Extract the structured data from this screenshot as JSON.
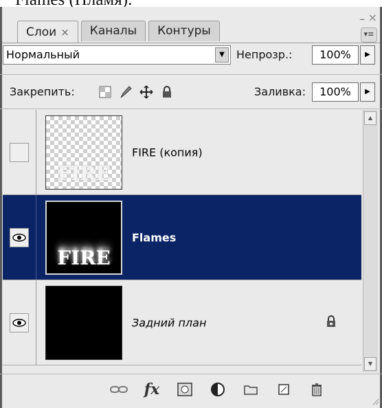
{
  "document": {
    "visible_fragment": "Flames (Пламя)."
  },
  "panel": {
    "tabs": [
      {
        "label": "Слои",
        "active": true,
        "close_glyph": "×"
      },
      {
        "label": "Каналы",
        "active": false
      },
      {
        "label": "Контуры",
        "active": false
      }
    ],
    "minimize_glyph": "–",
    "close_glyph": "×"
  },
  "blend_mode": {
    "value": "Нормальный"
  },
  "opacity": {
    "label": "Непрозр.:",
    "value": "100%"
  },
  "lock": {
    "label": "Закрепить:"
  },
  "fill": {
    "label": "Заливка:",
    "value": "100%"
  },
  "layers": [
    {
      "name": "FIRE (копия)",
      "visible": false,
      "selected": false,
      "thumb_text": "FIRE",
      "locked": false
    },
    {
      "name": "Flames",
      "visible": true,
      "selected": true,
      "thumb_text": "FIRE",
      "locked": false
    },
    {
      "name": "Задний план",
      "visible": true,
      "selected": false,
      "thumb_text": "",
      "locked": true
    }
  ],
  "bottom_toolbar": {
    "icons": [
      "link-layers-icon",
      "fx-icon",
      "layer-mask-icon",
      "adjustment-layer-icon",
      "new-group-icon",
      "new-layer-icon",
      "trash-icon"
    ],
    "fx_label": "fx"
  },
  "colors": {
    "selected_row": "#0b2465",
    "panel_bg": "#eaeaea"
  }
}
